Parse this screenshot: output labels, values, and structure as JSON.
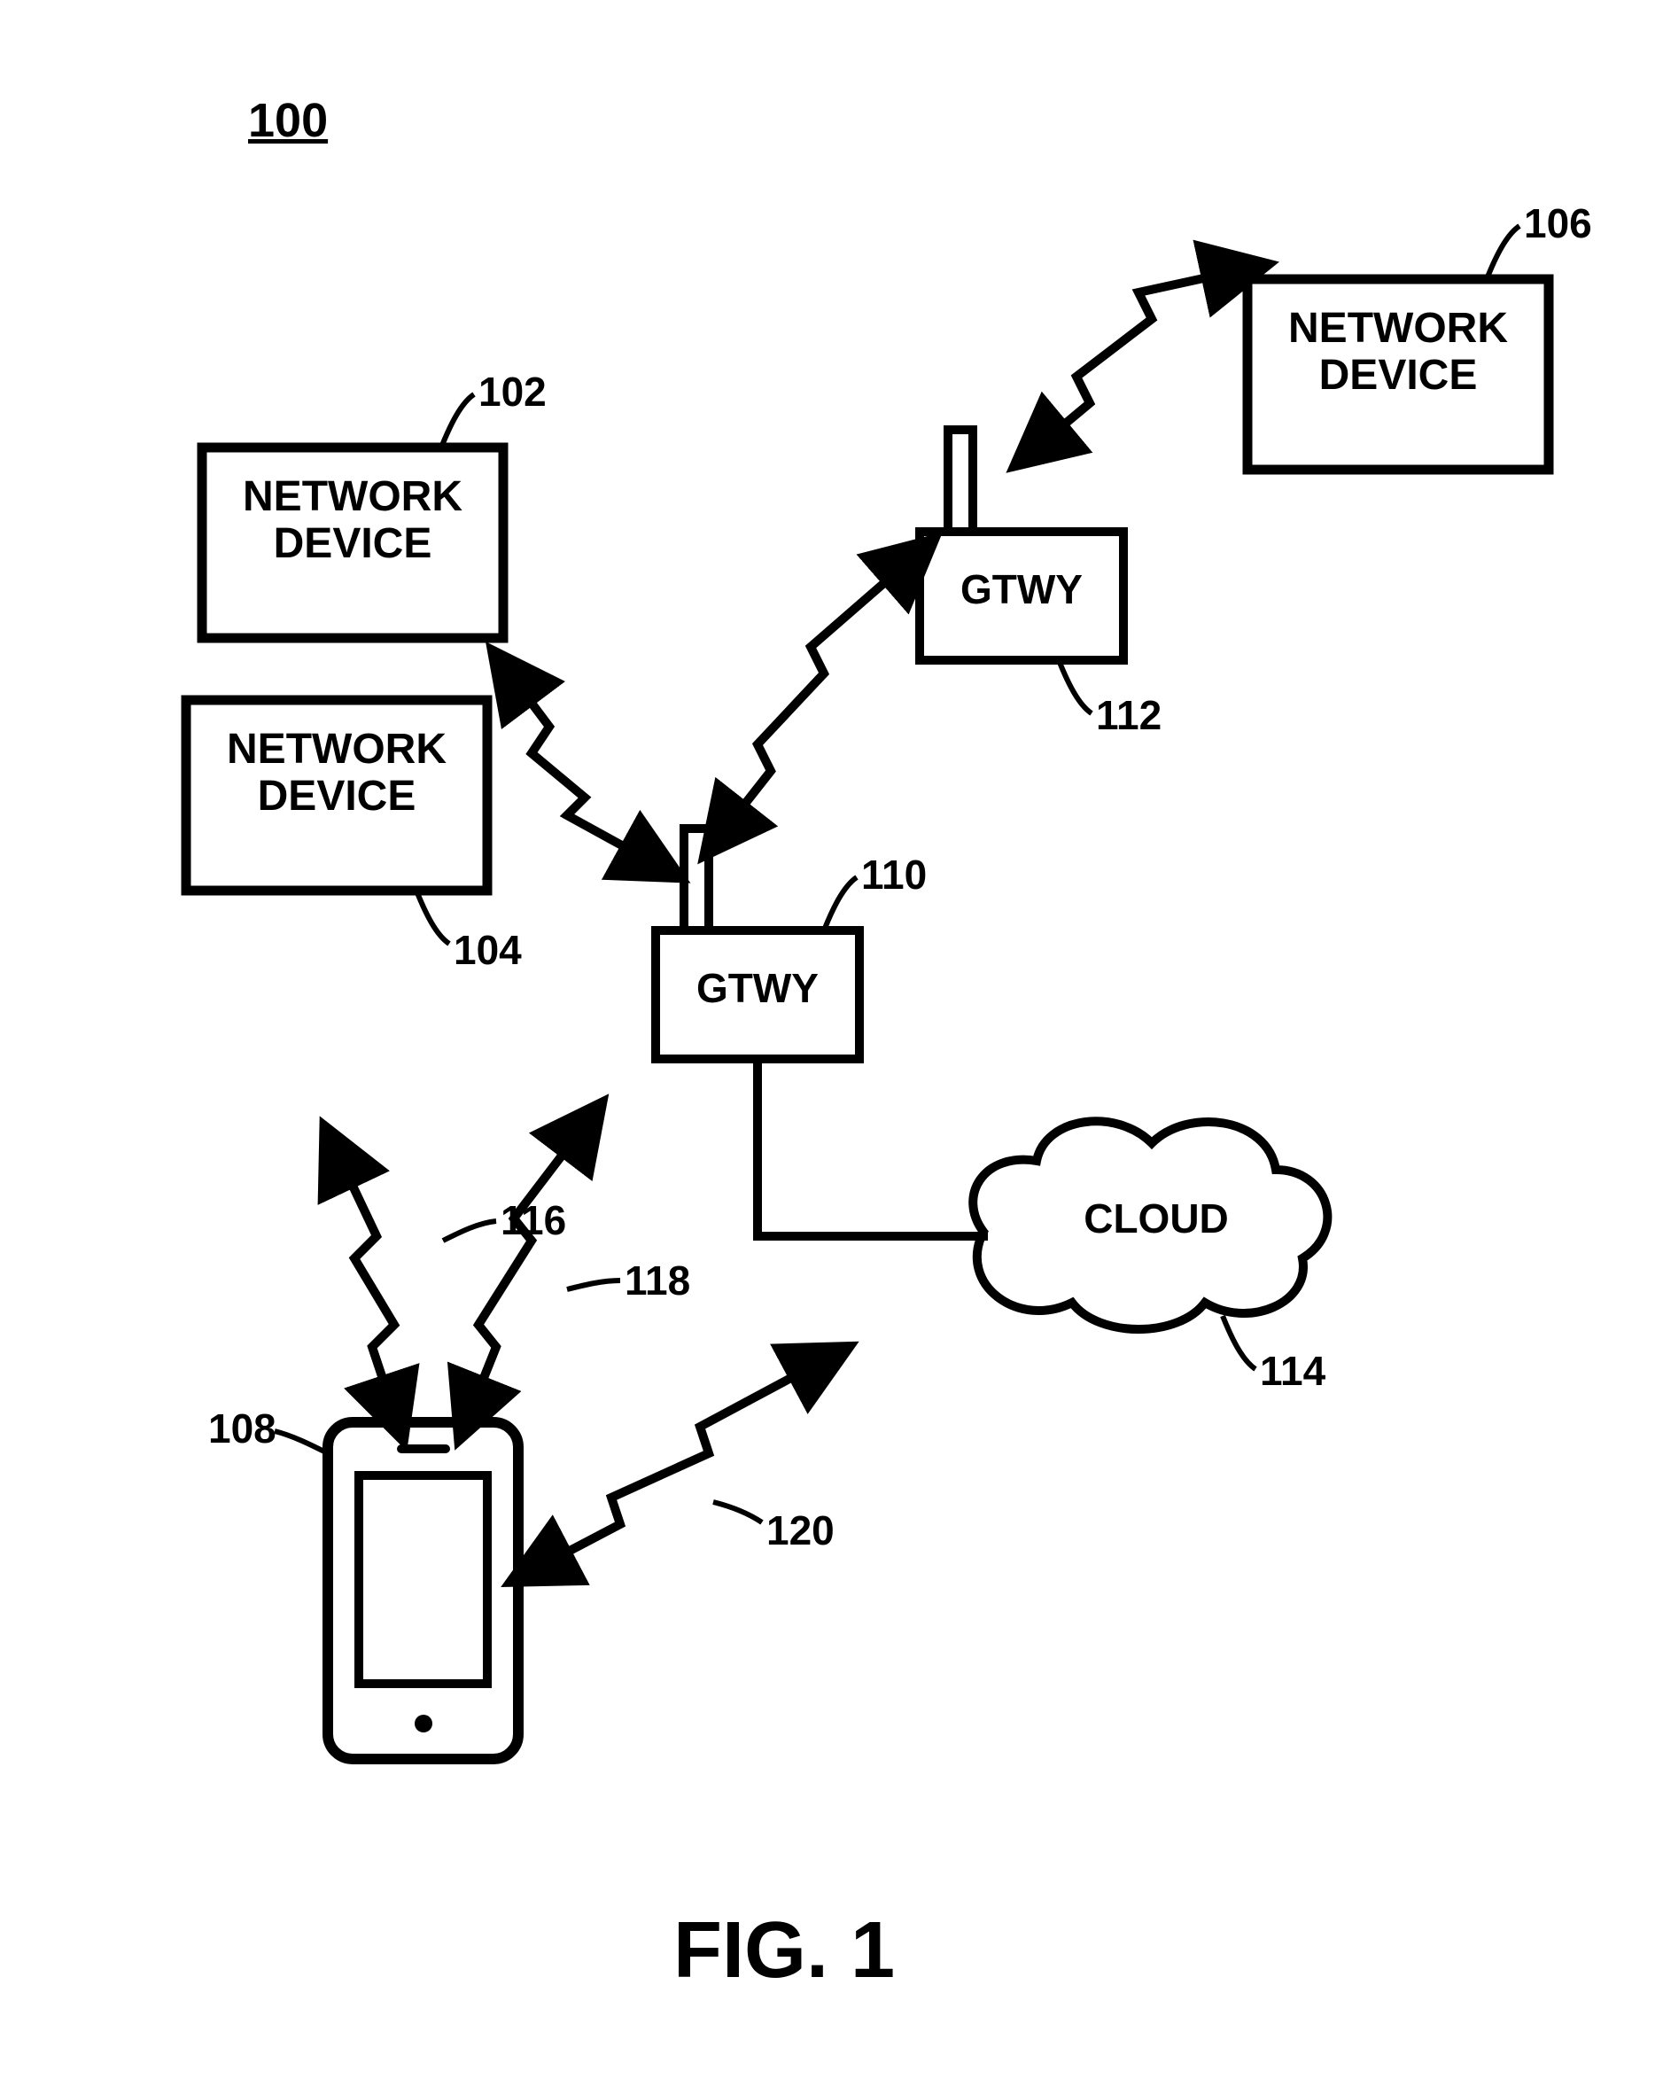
{
  "figure_ref": "100",
  "figure_title": "FIG. 1",
  "nodes": {
    "network_device_102": {
      "label": "NETWORK\nDEVICE",
      "ref": "102"
    },
    "network_device_104": {
      "label": "NETWORK\nDEVICE",
      "ref": "104"
    },
    "network_device_106": {
      "label": "NETWORK\nDEVICE",
      "ref": "106"
    },
    "gateway_110": {
      "label": "GTWY",
      "ref": "110"
    },
    "gateway_112": {
      "label": "GTWY",
      "ref": "112"
    },
    "cloud_114": {
      "label": "CLOUD",
      "ref": "114"
    },
    "phone_108": {
      "ref": "108"
    }
  },
  "link_refs": {
    "link_116": "116",
    "link_118": "118",
    "link_120": "120"
  }
}
